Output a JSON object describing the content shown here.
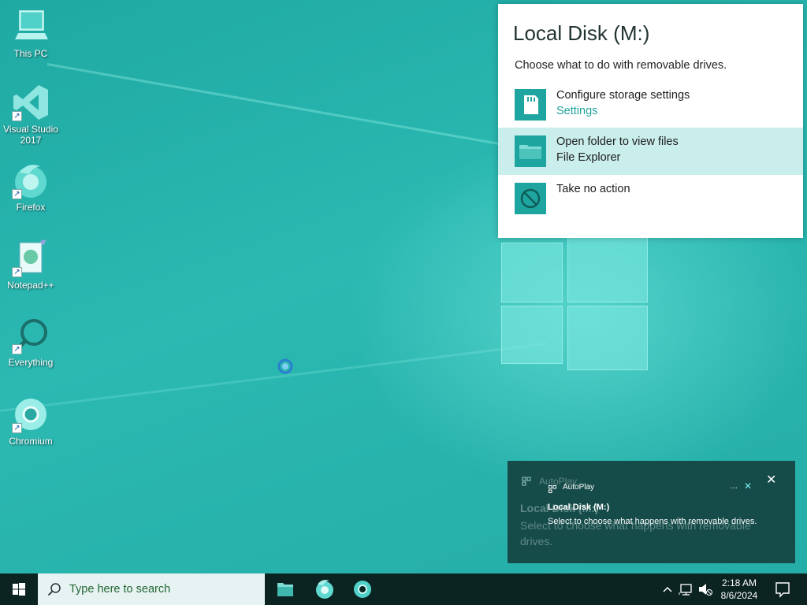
{
  "desktop": {
    "icons": [
      {
        "label": "This PC"
      },
      {
        "label": "Visual Studio 2017"
      },
      {
        "label": "Firefox"
      },
      {
        "label": "Notepad++"
      },
      {
        "label": "Everything"
      },
      {
        "label": "Chromium"
      }
    ]
  },
  "flyout": {
    "title": "Local Disk (M:)",
    "subtitle": "Choose what to do with removable drives.",
    "options": [
      {
        "label": "Configure storage settings",
        "detail": "Settings",
        "icon": "sd-card-icon"
      },
      {
        "label": "Open folder to view files",
        "detail": "File Explorer",
        "icon": "folder-icon",
        "highlighted": true
      },
      {
        "label": "Take no action",
        "detail": "",
        "icon": "no-action-icon"
      }
    ]
  },
  "toast": {
    "app_name": "AutoPlay",
    "title": "Local Disk (M:)",
    "body": "Select to choose what happens with removable drives.",
    "more_label": "...",
    "close_label": "✕"
  },
  "taskbar": {
    "search_placeholder": "Type here to search",
    "pinned": [
      "File Explorer",
      "Firefox",
      "Chromium"
    ],
    "clock_time": "2:18 AM",
    "clock_date": "8/6/2024"
  },
  "colors": {
    "desktop": "#27b4ad",
    "flyout_highlight": "#c9eeeb",
    "accent": "#22a29c",
    "toast_bg": "#154b49",
    "taskbar_bg": "#0b2321"
  }
}
